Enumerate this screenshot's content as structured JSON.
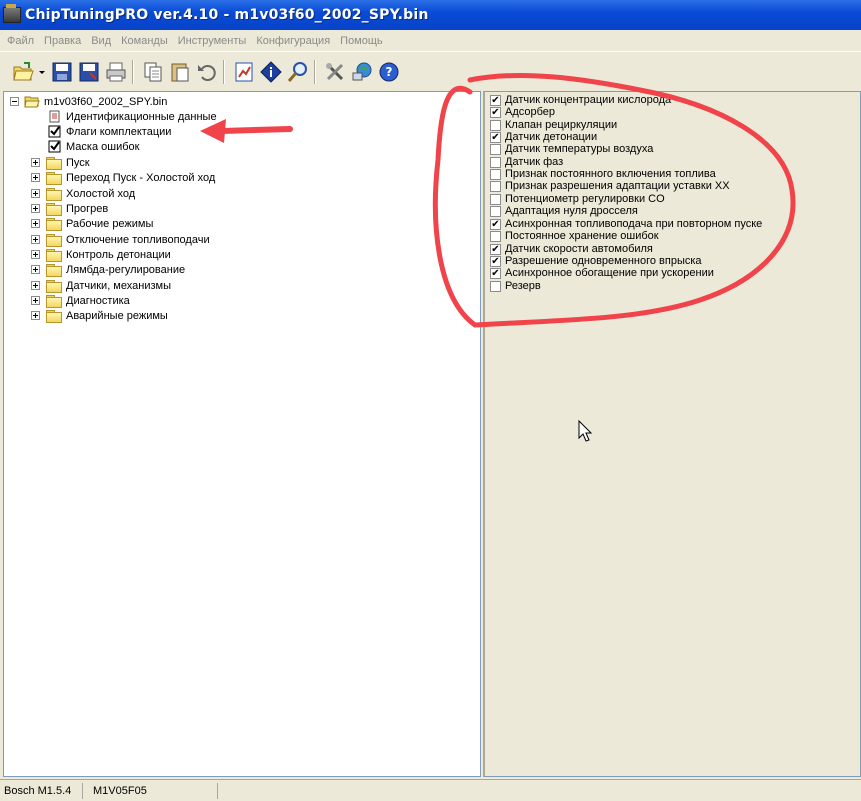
{
  "window": {
    "title": "ChipTuningPRO ver.4.10 - m1v03f60_2002_SPY.bin"
  },
  "menu": [
    "Файл",
    "Правка",
    "Вид",
    "Команды",
    "Инструменты",
    "Конфигурация",
    "Помощь"
  ],
  "toolbar": {
    "icons": [
      "open-icon",
      "dropdown-icon",
      "save-icon",
      "save-as-icon",
      "print-icon",
      "copy-icon",
      "paste-icon",
      "undo-icon",
      "chart-icon",
      "info-icon",
      "search-icon",
      "tools-icon",
      "network-icon",
      "help-icon"
    ]
  },
  "tree": {
    "root": "m1v03f60_2002_SPY.bin",
    "leaves": [
      "Идентификационные данные",
      "Флаги комплектации",
      "Маска ошибок"
    ],
    "folders": [
      "Пуск",
      "Переход Пуск - Холостой ход",
      "Холостой ход",
      "Прогрев",
      "Рабочие режимы",
      "Отключение топливоподачи",
      "Контроль детонации",
      "Лямбда-регулирование",
      "Датчики, механизмы",
      "Диагностика",
      "Аварийные режимы"
    ]
  },
  "flags": [
    {
      "label": "Датчик концентрации кислорода",
      "checked": true
    },
    {
      "label": "Адсорбер",
      "checked": true
    },
    {
      "label": "Клапан рециркуляции",
      "checked": false
    },
    {
      "label": "Датчик детонации",
      "checked": true
    },
    {
      "label": "Датчик температуры воздуха",
      "checked": false
    },
    {
      "label": "Датчик фаз",
      "checked": false
    },
    {
      "label": "Признак постоянного включения топлива",
      "checked": false
    },
    {
      "label": "Признак разрешения адаптации уставки ХХ",
      "checked": false
    },
    {
      "label": "Потенциометр регулировки CO",
      "checked": false
    },
    {
      "label": "Адаптация нуля дросселя",
      "checked": false
    },
    {
      "label": "Асинхронная топливоподача при повторном пуске",
      "checked": true
    },
    {
      "label": "Постоянное хранение ошибок",
      "checked": false
    },
    {
      "label": "Датчик скорости автомобиля",
      "checked": true
    },
    {
      "label": "Разрешение одновременного впрыска",
      "checked": true
    },
    {
      "label": "Асинхронное обогащение при ускорении",
      "checked": true
    },
    {
      "label": "Резерв",
      "checked": false
    }
  ],
  "status": {
    "ecu": "Bosch M1.5.4",
    "firmware": "M1V05F05"
  },
  "colors": {
    "annotation": "#f0434a",
    "titlebar": "#0a4bd6"
  }
}
